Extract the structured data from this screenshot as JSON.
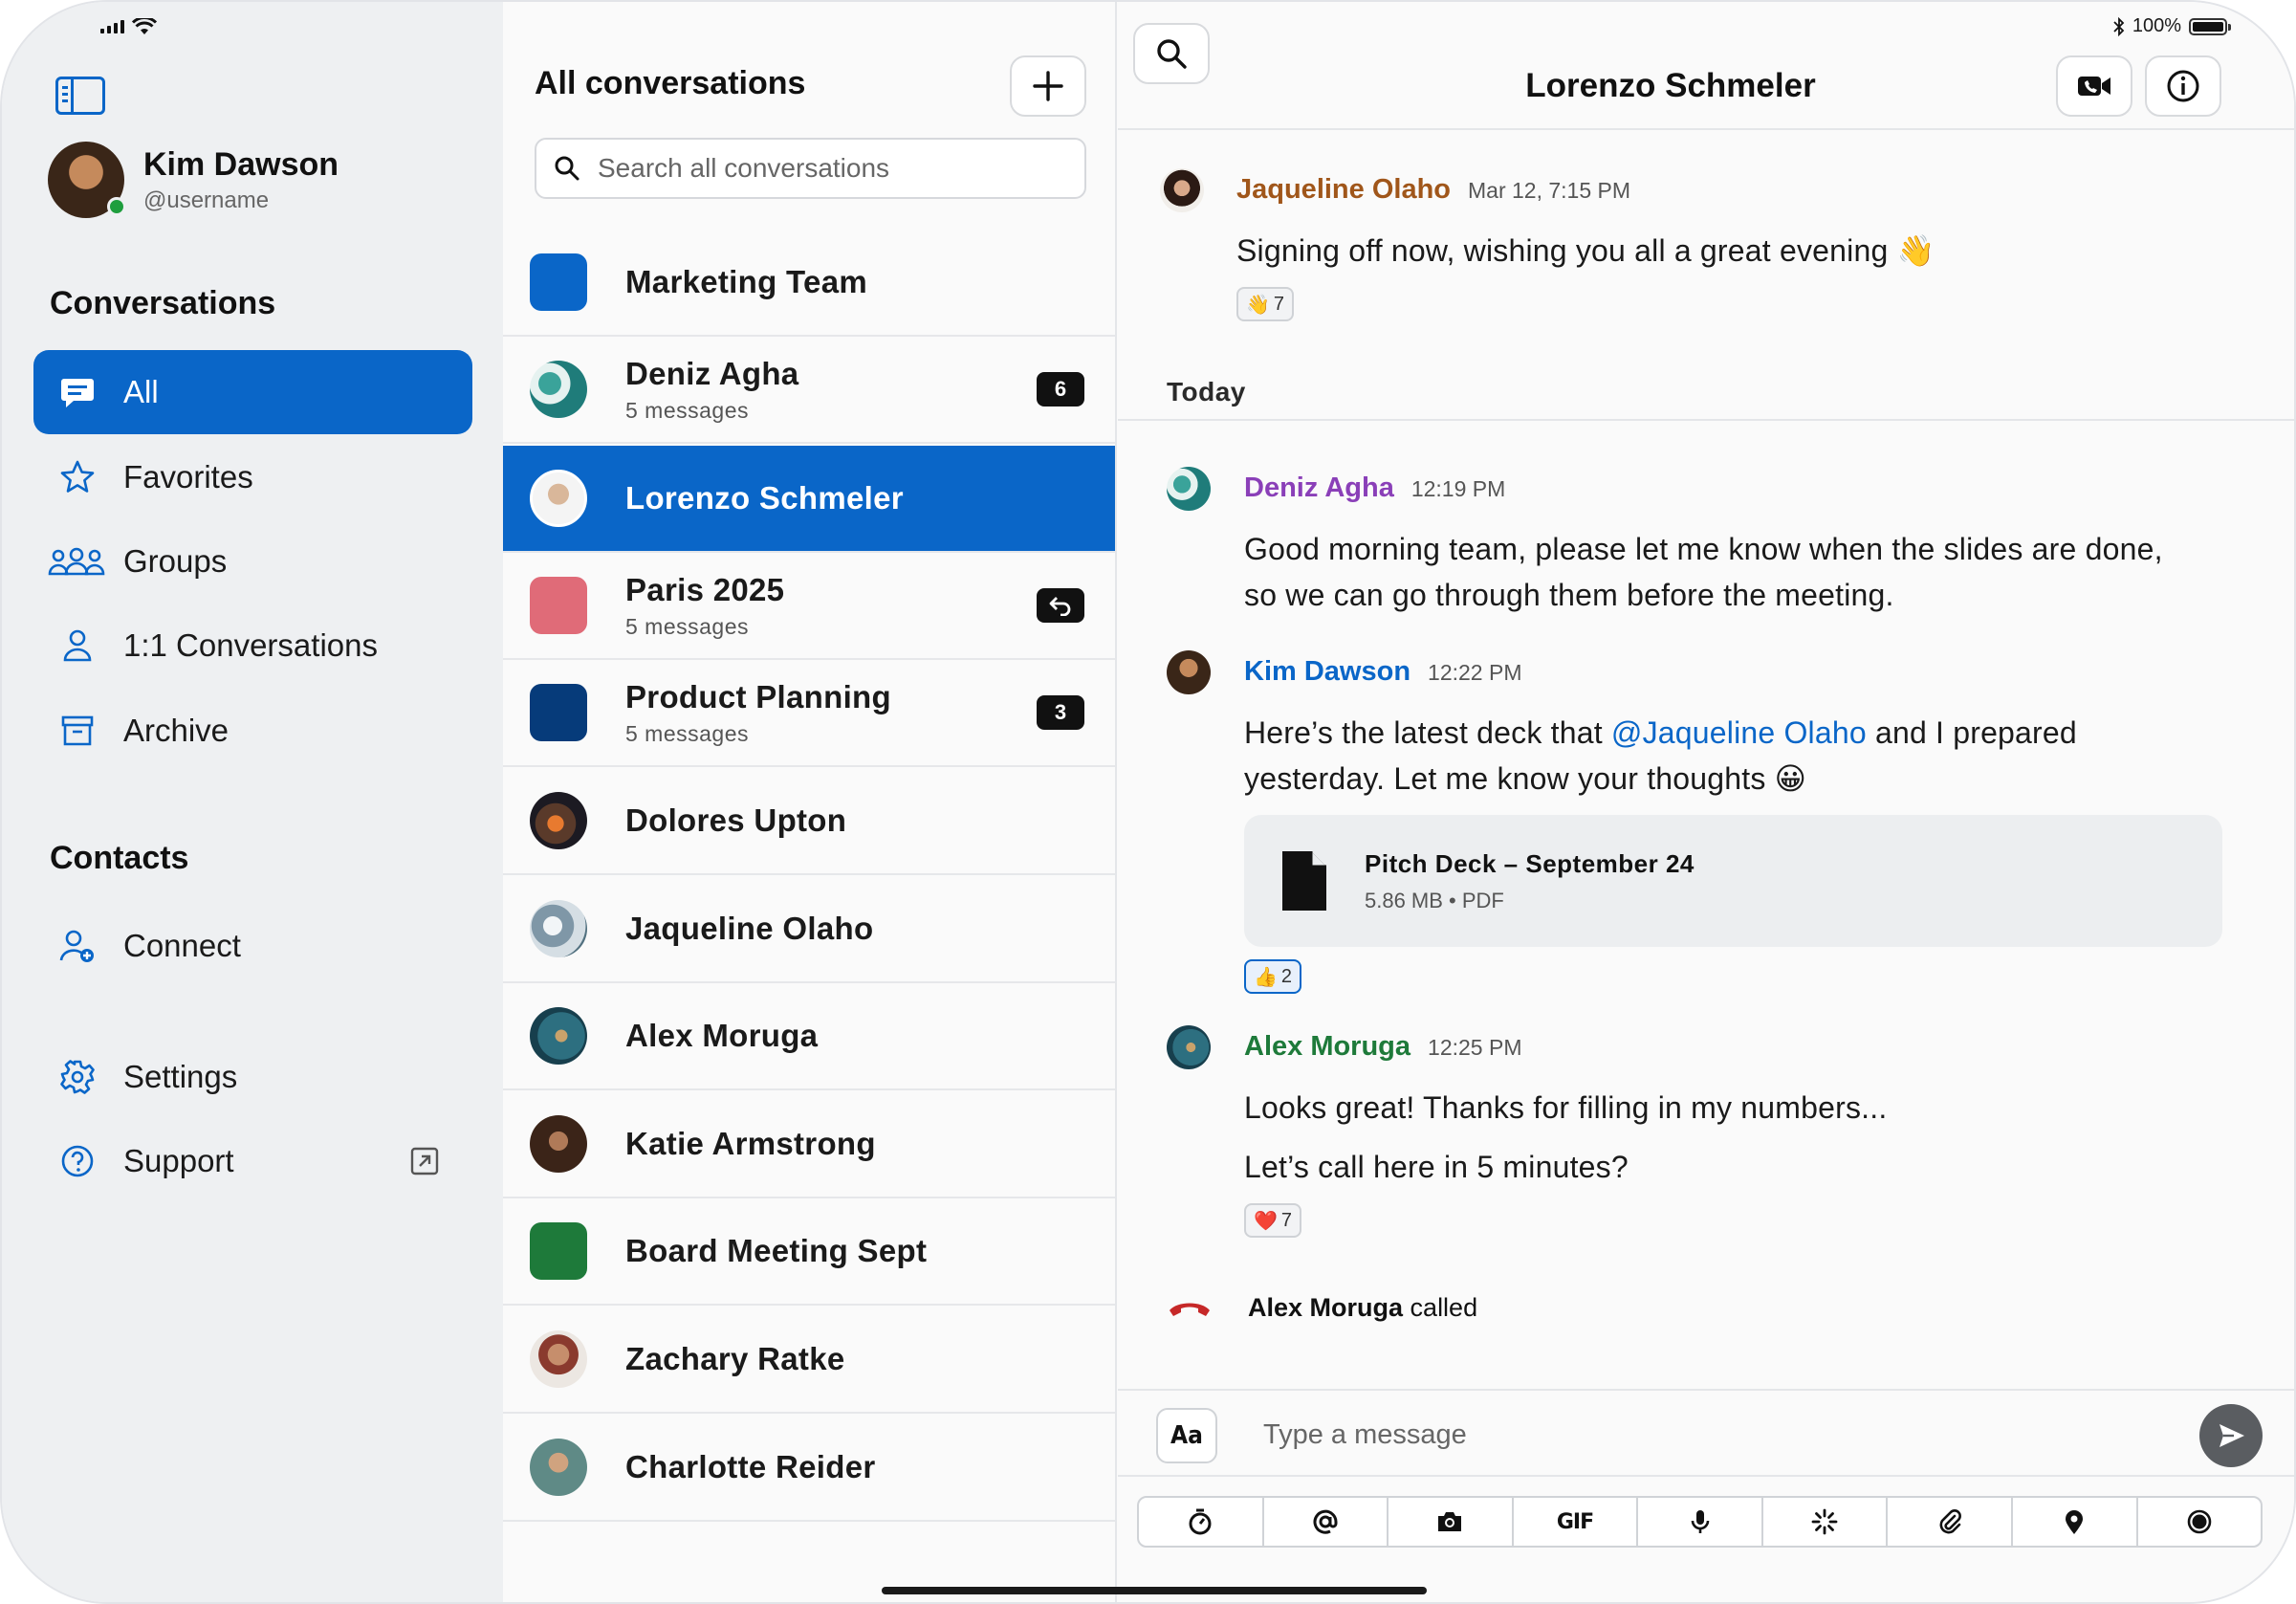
{
  "status_bar": {
    "battery": "100%"
  },
  "colors": {
    "accent": "#0a66c8",
    "sender_jaqueline": "#a0561a",
    "sender_deniz": "#8a3fb8",
    "sender_kim": "#0a66c8",
    "sender_alex": "#1e7a3a",
    "call_missed": "#c62828"
  },
  "sidebar": {
    "profile": {
      "name": "Kim Dawson",
      "username": "@username"
    },
    "conversations_title": "Conversations",
    "items": [
      {
        "label": "All",
        "icon": "chat-bubble-icon",
        "active": true
      },
      {
        "label": "Favorites",
        "icon": "star-icon"
      },
      {
        "label": "Groups",
        "icon": "group-icon"
      },
      {
        "label": "1:1 Conversations",
        "icon": "person-icon"
      },
      {
        "label": "Archive",
        "icon": "archive-icon"
      }
    ],
    "contacts_title": "Contacts",
    "connect_label": "Connect",
    "settings_label": "Settings",
    "support_label": "Support"
  },
  "conversation_list": {
    "title": "All conversations",
    "search_placeholder": "Search all conversations",
    "items": [
      {
        "title": "Marketing Team",
        "subtitle": "",
        "badge": "",
        "avatar_color": "#0a66c8"
      },
      {
        "title": "Deniz Agha",
        "subtitle": "5 messages",
        "badge": "6"
      },
      {
        "title": "Lorenzo Schmeler",
        "subtitle": "",
        "badge": "",
        "active": true
      },
      {
        "title": "Paris 2025",
        "subtitle": "5 messages",
        "badge": "reply-icon",
        "avatar_color": "#e06b78"
      },
      {
        "title": "Product Planning",
        "subtitle": "5 messages",
        "badge": "3",
        "avatar_color": "#063b7a"
      },
      {
        "title": "Dolores Upton",
        "subtitle": "",
        "badge": ""
      },
      {
        "title": "Jaqueline Olaho",
        "subtitle": "",
        "badge": ""
      },
      {
        "title": "Alex Moruga",
        "subtitle": "",
        "badge": ""
      },
      {
        "title": "Katie Armstrong",
        "subtitle": "",
        "badge": ""
      },
      {
        "title": "Board Meeting Sept",
        "subtitle": "",
        "badge": "",
        "avatar_color": "#1e7a3a"
      },
      {
        "title": "Zachary Ratke",
        "subtitle": "",
        "badge": ""
      },
      {
        "title": "Charlotte Reider",
        "subtitle": "",
        "badge": ""
      }
    ]
  },
  "chat": {
    "title": "Lorenzo Schmeler",
    "day_separator": "Today",
    "messages": [
      {
        "sender": "Jaqueline Olaho",
        "time": "Mar 12, 7:15 PM",
        "text": "Signing off now, wishing you all a great evening 👋",
        "reaction_emoji": "👋",
        "reaction_count": "7"
      },
      {
        "sender": "Deniz Agha",
        "time": "12:19 PM",
        "text_line1": "Good morning team, please let me know when the slides are done,",
        "text_line2": "so we can go through them before the meeting."
      },
      {
        "sender": "Kim Dawson",
        "time": "12:22 PM",
        "text_before": "Here’s the latest deck that ",
        "mention": "@Jaqueline Olaho",
        "text_after": " and I prepared",
        "text_line2": "yesterday. Let me know your thoughts 😀",
        "reaction_emoji": "👍",
        "reaction_count": "2"
      },
      {
        "sender": "Alex Moruga",
        "time": "12:25 PM",
        "text_line1": "Looks great! Thanks for filling in my numbers...",
        "text_line2": "Let’s call here in 5 minutes?",
        "reaction_emoji": "❤️",
        "reaction_count": "7"
      }
    ],
    "file": {
      "name": "Pitch Deck – September 24",
      "meta": "5.86 MB • PDF"
    },
    "call": {
      "caller": "Alex Moruga",
      "action": "called"
    },
    "composer": {
      "format_label": "Aa",
      "placeholder": "Type a message",
      "tools": [
        "timer-icon",
        "mention-icon",
        "camera-icon",
        "GIF",
        "microphone-icon",
        "sparkle-icon",
        "paperclip-icon",
        "location-pin-icon",
        "record-icon"
      ]
    }
  }
}
